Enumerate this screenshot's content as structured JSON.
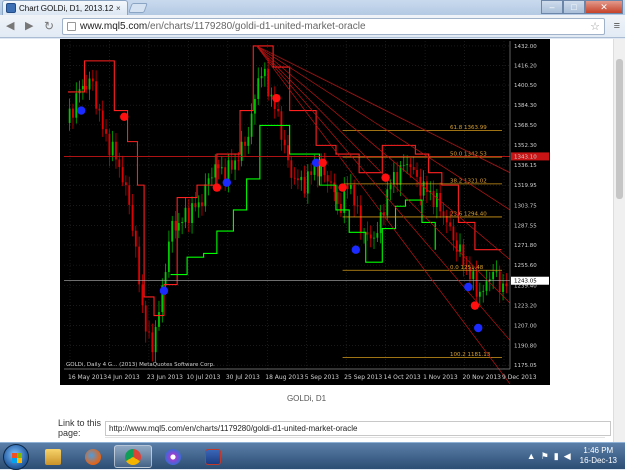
{
  "browser": {
    "tab_title": "Chart GOLDi, D1, 2013.12.",
    "tab_close": "×",
    "url_prefix": "www.mql5.com",
    "url_path": "/en/charts/1179280/goldi-d1-united-market-oracle",
    "window_buttons": {
      "minimize": "–",
      "maximize": "□",
      "close": "✕"
    }
  },
  "chart_caption": "GOLDi, D1",
  "link": {
    "label": "Link to this page:",
    "value": "http://www.mql5.com/en/charts/1179280/goldi-d1-united-market-oracle"
  },
  "taskbar": {
    "time": "1:46 PM",
    "date": "16-Dec-13",
    "apps": [
      "explorer-icon",
      "firefox-icon",
      "chrome-icon",
      "itunes-icon",
      "metatrader-icon"
    ]
  },
  "colors": {
    "chart_bg": "#000000",
    "up_candle": "#00c800",
    "down_candle": "#e00000",
    "support_line": "#00ff00",
    "resistance_line": "#ff2020",
    "fib_line": "#d49a1a",
    "signal_buy": "#1b2bff",
    "signal_sell": "#ff1010"
  },
  "chart_data": {
    "type": "candlestick",
    "symbol": "GOLDi",
    "timeframe": "D1",
    "y_ticks": [
      1432.0,
      1416.2,
      1400.5,
      1384.3,
      1368.5,
      1352.3,
      1336.15,
      1319.95,
      1303.75,
      1287.55,
      1271.8,
      1255.6,
      1239.4,
      1223.2,
      1207.0,
      1190.8,
      1175.05
    ],
    "ylim": [
      1172,
      1436
    ],
    "x_ticks": [
      "16 May 2013",
      "4 Jun 2013",
      "23 Jun 2013",
      "10 Jul 2013",
      "30 Jul 2013",
      "18 Aug 2013",
      "5 Sep 2013",
      "25 Sep 2013",
      "14 Oct 2013",
      "1 Nov 2013",
      "20 Nov 2013",
      "9 Dec 2013"
    ],
    "fib_levels": [
      {
        "label": "61.8 1363.99",
        "value": 1363.99
      },
      {
        "label": "50.0 1342.53",
        "value": 1342.53
      },
      {
        "label": "38.2 1321.02",
        "value": 1321.02
      },
      {
        "label": "23.6 1294.40",
        "value": 1294.4
      },
      {
        "label": "0.0 1251.48",
        "value": 1251.48
      },
      {
        "label": "100.2 1181.13",
        "value": 1181.13
      }
    ],
    "current_price": 1243.05,
    "red_hline": 1343.1,
    "watermark": "GOLDi, Daily 4  G... (2013) MetaQuotes Software Corp."
  }
}
